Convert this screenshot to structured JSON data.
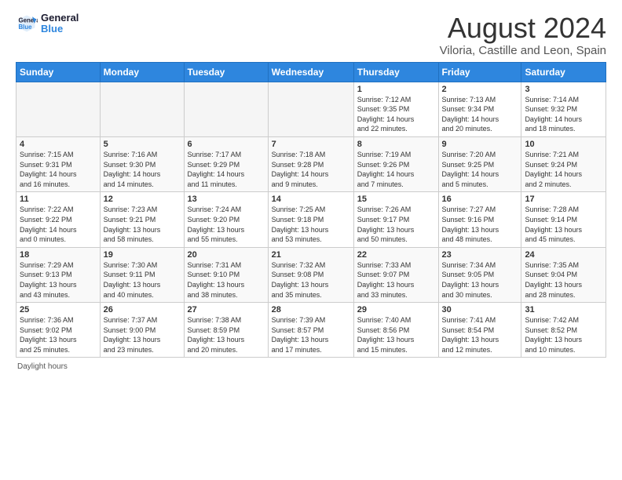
{
  "logo": {
    "line1": "General",
    "line2": "Blue"
  },
  "title": "August 2024",
  "subtitle": "Viloria, Castille and Leon, Spain",
  "days_header": [
    "Sunday",
    "Monday",
    "Tuesday",
    "Wednesday",
    "Thursday",
    "Friday",
    "Saturday"
  ],
  "weeks": [
    [
      {
        "num": "",
        "info": ""
      },
      {
        "num": "",
        "info": ""
      },
      {
        "num": "",
        "info": ""
      },
      {
        "num": "",
        "info": ""
      },
      {
        "num": "1",
        "info": "Sunrise: 7:12 AM\nSunset: 9:35 PM\nDaylight: 14 hours\nand 22 minutes."
      },
      {
        "num": "2",
        "info": "Sunrise: 7:13 AM\nSunset: 9:34 PM\nDaylight: 14 hours\nand 20 minutes."
      },
      {
        "num": "3",
        "info": "Sunrise: 7:14 AM\nSunset: 9:32 PM\nDaylight: 14 hours\nand 18 minutes."
      }
    ],
    [
      {
        "num": "4",
        "info": "Sunrise: 7:15 AM\nSunset: 9:31 PM\nDaylight: 14 hours\nand 16 minutes."
      },
      {
        "num": "5",
        "info": "Sunrise: 7:16 AM\nSunset: 9:30 PM\nDaylight: 14 hours\nand 14 minutes."
      },
      {
        "num": "6",
        "info": "Sunrise: 7:17 AM\nSunset: 9:29 PM\nDaylight: 14 hours\nand 11 minutes."
      },
      {
        "num": "7",
        "info": "Sunrise: 7:18 AM\nSunset: 9:28 PM\nDaylight: 14 hours\nand 9 minutes."
      },
      {
        "num": "8",
        "info": "Sunrise: 7:19 AM\nSunset: 9:26 PM\nDaylight: 14 hours\nand 7 minutes."
      },
      {
        "num": "9",
        "info": "Sunrise: 7:20 AM\nSunset: 9:25 PM\nDaylight: 14 hours\nand 5 minutes."
      },
      {
        "num": "10",
        "info": "Sunrise: 7:21 AM\nSunset: 9:24 PM\nDaylight: 14 hours\nand 2 minutes."
      }
    ],
    [
      {
        "num": "11",
        "info": "Sunrise: 7:22 AM\nSunset: 9:22 PM\nDaylight: 14 hours\nand 0 minutes."
      },
      {
        "num": "12",
        "info": "Sunrise: 7:23 AM\nSunset: 9:21 PM\nDaylight: 13 hours\nand 58 minutes."
      },
      {
        "num": "13",
        "info": "Sunrise: 7:24 AM\nSunset: 9:20 PM\nDaylight: 13 hours\nand 55 minutes."
      },
      {
        "num": "14",
        "info": "Sunrise: 7:25 AM\nSunset: 9:18 PM\nDaylight: 13 hours\nand 53 minutes."
      },
      {
        "num": "15",
        "info": "Sunrise: 7:26 AM\nSunset: 9:17 PM\nDaylight: 13 hours\nand 50 minutes."
      },
      {
        "num": "16",
        "info": "Sunrise: 7:27 AM\nSunset: 9:16 PM\nDaylight: 13 hours\nand 48 minutes."
      },
      {
        "num": "17",
        "info": "Sunrise: 7:28 AM\nSunset: 9:14 PM\nDaylight: 13 hours\nand 45 minutes."
      }
    ],
    [
      {
        "num": "18",
        "info": "Sunrise: 7:29 AM\nSunset: 9:13 PM\nDaylight: 13 hours\nand 43 minutes."
      },
      {
        "num": "19",
        "info": "Sunrise: 7:30 AM\nSunset: 9:11 PM\nDaylight: 13 hours\nand 40 minutes."
      },
      {
        "num": "20",
        "info": "Sunrise: 7:31 AM\nSunset: 9:10 PM\nDaylight: 13 hours\nand 38 minutes."
      },
      {
        "num": "21",
        "info": "Sunrise: 7:32 AM\nSunset: 9:08 PM\nDaylight: 13 hours\nand 35 minutes."
      },
      {
        "num": "22",
        "info": "Sunrise: 7:33 AM\nSunset: 9:07 PM\nDaylight: 13 hours\nand 33 minutes."
      },
      {
        "num": "23",
        "info": "Sunrise: 7:34 AM\nSunset: 9:05 PM\nDaylight: 13 hours\nand 30 minutes."
      },
      {
        "num": "24",
        "info": "Sunrise: 7:35 AM\nSunset: 9:04 PM\nDaylight: 13 hours\nand 28 minutes."
      }
    ],
    [
      {
        "num": "25",
        "info": "Sunrise: 7:36 AM\nSunset: 9:02 PM\nDaylight: 13 hours\nand 25 minutes."
      },
      {
        "num": "26",
        "info": "Sunrise: 7:37 AM\nSunset: 9:00 PM\nDaylight: 13 hours\nand 23 minutes."
      },
      {
        "num": "27",
        "info": "Sunrise: 7:38 AM\nSunset: 8:59 PM\nDaylight: 13 hours\nand 20 minutes."
      },
      {
        "num": "28",
        "info": "Sunrise: 7:39 AM\nSunset: 8:57 PM\nDaylight: 13 hours\nand 17 minutes."
      },
      {
        "num": "29",
        "info": "Sunrise: 7:40 AM\nSunset: 8:56 PM\nDaylight: 13 hours\nand 15 minutes."
      },
      {
        "num": "30",
        "info": "Sunrise: 7:41 AM\nSunset: 8:54 PM\nDaylight: 13 hours\nand 12 minutes."
      },
      {
        "num": "31",
        "info": "Sunrise: 7:42 AM\nSunset: 8:52 PM\nDaylight: 13 hours\nand 10 minutes."
      }
    ]
  ],
  "footer": "Daylight hours"
}
